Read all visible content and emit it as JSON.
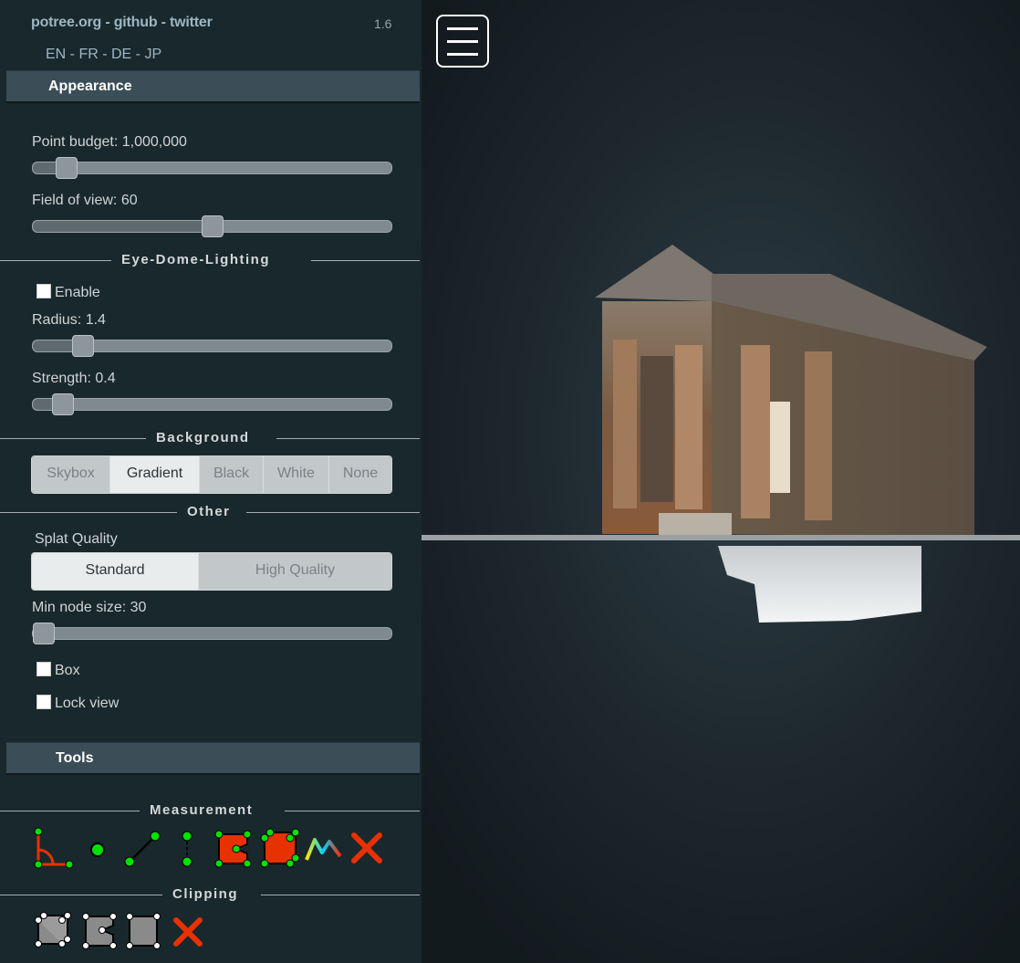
{
  "header": {
    "links": "potree.org - github - twitter",
    "version": "1.6",
    "languages": "EN - FR - DE - JP"
  },
  "appearance": {
    "title": "Appearance",
    "point_budget_label": "Point budget: 1,000,000",
    "point_budget_value": 0.095,
    "fov_label": "Field of view: 60",
    "fov_value": 0.5,
    "edl_section": "Eye-Dome-Lighting",
    "edl_enable_label": "Enable",
    "edl_radius_label": "Radius: 1.4",
    "edl_radius_value": 0.14,
    "edl_strength_label": "Strength: 0.4",
    "edl_strength_value": 0.085,
    "background_section": "Background",
    "background_options": [
      "Skybox",
      "Gradient",
      "Black",
      "White",
      "None"
    ],
    "background_selected": "Gradient",
    "other_section": "Other",
    "splat_label": "Splat Quality",
    "splat_options": [
      "Standard",
      "High Quality"
    ],
    "splat_selected": "Standard",
    "min_node_label": "Min node size: 30",
    "min_node_value": 0.03,
    "box_label": "Box",
    "lock_view_label": "Lock view"
  },
  "tools": {
    "title": "Tools",
    "measurement_section": "Measurement",
    "measurement_icons": [
      "angle-icon",
      "point-icon",
      "distance-icon",
      "height-icon",
      "area-icon",
      "volume-icon",
      "profile-icon",
      "remove-measurements-icon"
    ],
    "clipping_section": "Clipping",
    "clipping_icons": [
      "clip-volume-icon",
      "clip-polygon-icon",
      "clip-screen-box-icon",
      "remove-clipping-icon"
    ]
  },
  "colors": {
    "accent": "#9db6c4",
    "panel_header": "#3b4e57",
    "sidebar_bg": "#19282c",
    "remove_red": "#e73100",
    "marker_green": "#00e000"
  }
}
